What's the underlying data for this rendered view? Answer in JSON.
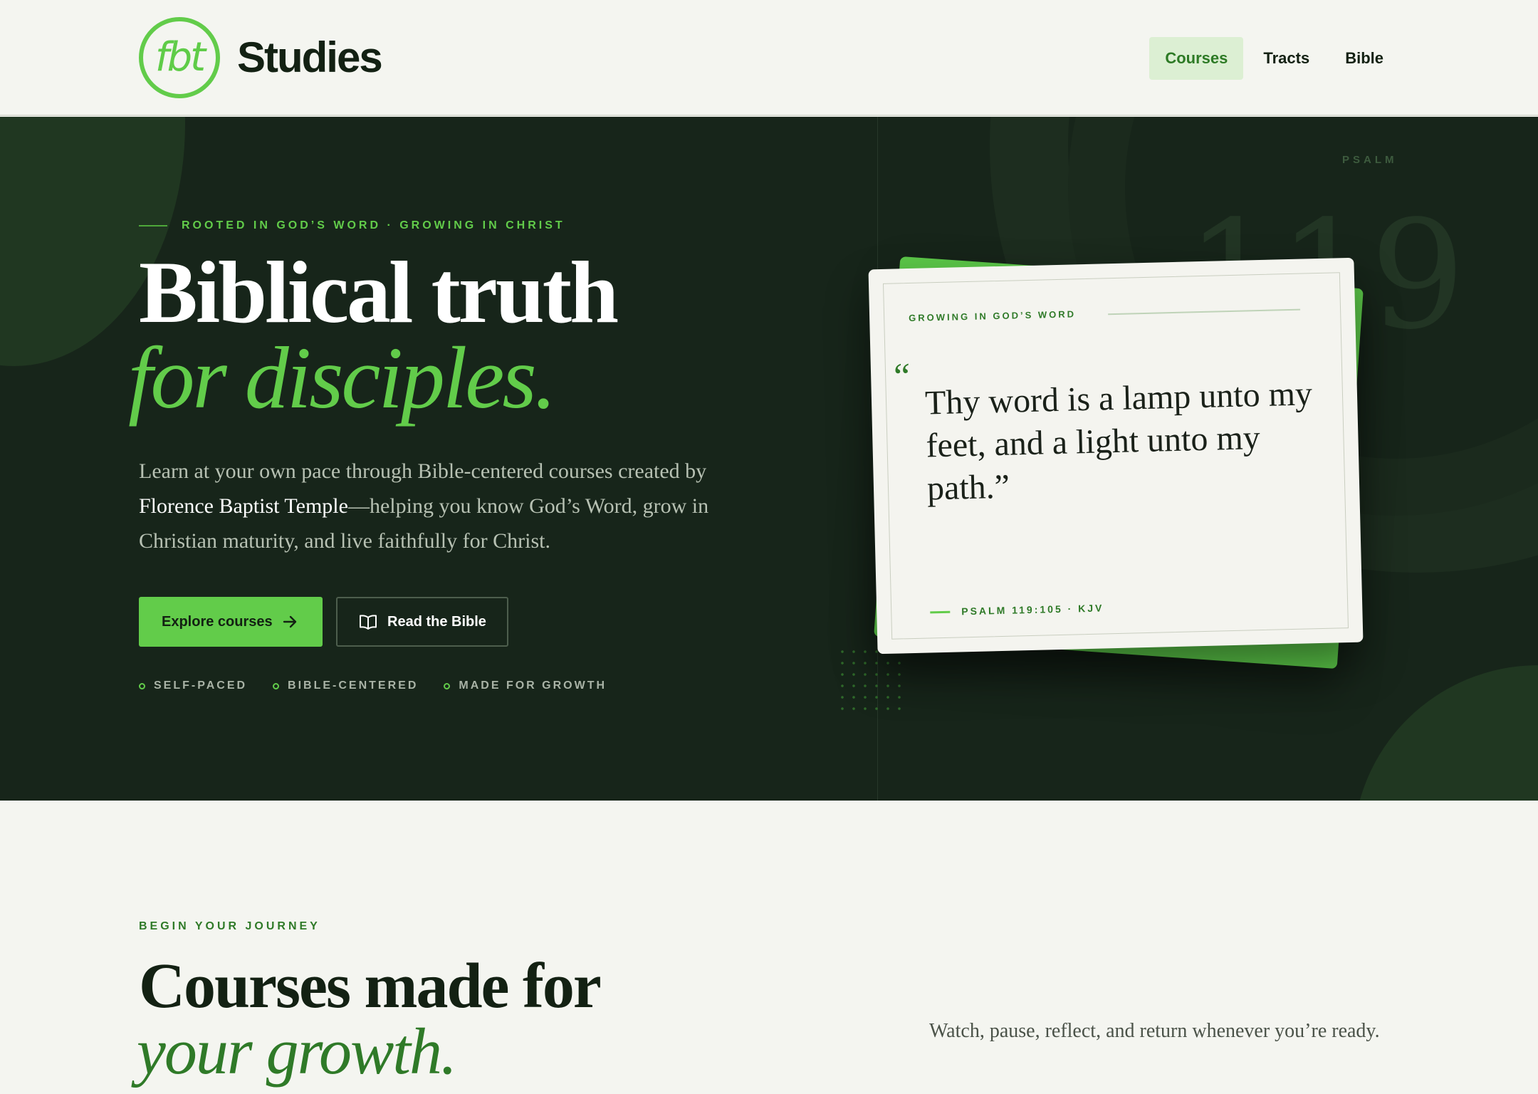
{
  "header": {
    "logo_text": "fbt",
    "brand": "Studies",
    "nav": [
      {
        "label": "Courses",
        "active": true
      },
      {
        "label": "Tracts",
        "active": false
      },
      {
        "label": "Bible",
        "active": false
      }
    ]
  },
  "hero": {
    "eyebrow": "ROOTED IN GOD’S WORD · GROWING IN CHRIST",
    "title_line1": "Biblical truth",
    "title_line2": "for disciples.",
    "lede_before": "Learn at your own pace through Bible-centered courses created by ",
    "lede_highlight": "Florence Baptist Temple",
    "lede_after": "—helping you know God’s Word, grow in Christian maturity, and live faithfully for Christ.",
    "primary_button": "Explore courses",
    "secondary_button": "Read the Bible",
    "features": [
      "SELF-PACED",
      "BIBLE-CENTERED",
      "MADE FOR GROWTH"
    ],
    "side_tag": "PSALM",
    "side_number": "119"
  },
  "verse_card": {
    "eyebrow": "GROWING IN GOD’S WORD",
    "quote_mark": "“",
    "quote": "Thy word is a lamp unto my feet, and a light unto my path.”",
    "reference": "PSALM 119:105 · KJV"
  },
  "section": {
    "eyebrow": "BEGIN YOUR JOURNEY",
    "title_line1": "Courses made for",
    "title_line2": "your growth.",
    "side_text": "Watch, pause, reflect, and return whenever you’re ready."
  },
  "colors": {
    "accent": "#62cc4a",
    "dark_green": "#17251a",
    "deep_green_text": "#2f7a28",
    "page_bg": "#f4f5f0"
  }
}
